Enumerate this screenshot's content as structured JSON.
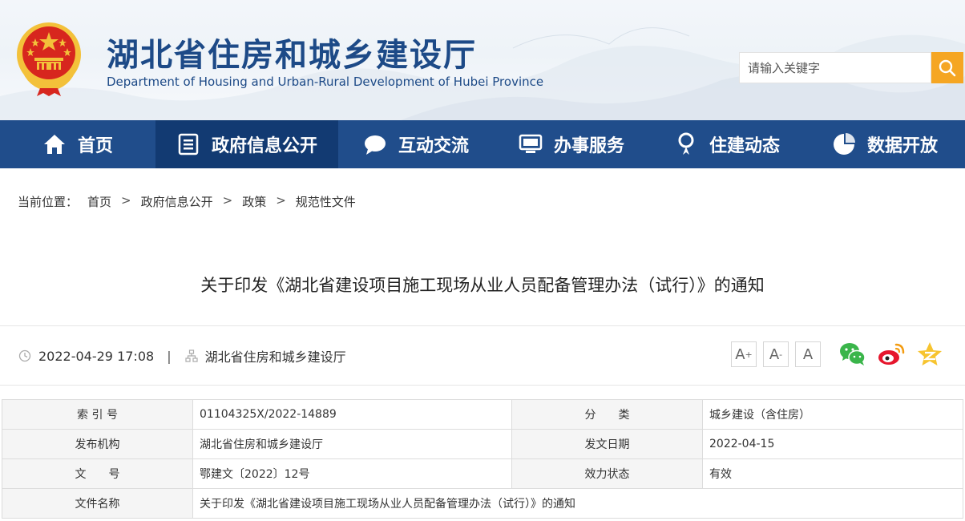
{
  "header": {
    "title": "湖北省住房和城乡建设厅",
    "subtitle": "Department of Housing and Urban-Rural Development of Hubei Province",
    "search_placeholder": "请输入关键字"
  },
  "nav": {
    "items": [
      {
        "label": "首页",
        "icon": "home-icon"
      },
      {
        "label": "政府信息公开",
        "icon": "document-list-icon",
        "active": true
      },
      {
        "label": "互动交流",
        "icon": "chat-bubble-icon"
      },
      {
        "label": "办事服务",
        "icon": "monitor-icon"
      },
      {
        "label": "住建动态",
        "icon": "location-pin-icon"
      },
      {
        "label": "数据开放",
        "icon": "pie-chart-icon"
      }
    ]
  },
  "breadcrumb": {
    "prefix": "当前位置：",
    "items": [
      "首页",
      "政府信息公开",
      "政策",
      "规范性文件"
    ],
    "separator": ">"
  },
  "article": {
    "title": "关于印发《湖北省建设项目施工现场从业人员配备管理办法（试行）》的通知",
    "datetime": "2022-04-29 17:08",
    "pipe": "|",
    "source": "湖北省住房和城乡建设厅"
  },
  "font_controls": {
    "increase": "A",
    "increase_sup": "+",
    "decrease": "A",
    "decrease_sup": "-",
    "reset": "A"
  },
  "share": [
    "wechat-icon",
    "weibo-icon",
    "qzone-icon"
  ],
  "info_table": {
    "rows": [
      {
        "l1": "索 引 号",
        "v1": "01104325X/2022-14889",
        "l2": "分　　类",
        "v2": "城乡建设（含住房）"
      },
      {
        "l1": "发布机构",
        "v1": "湖北省住房和城乡建设厅",
        "l2": "发文日期",
        "v2": "2022-04-15"
      },
      {
        "l1": "文　　号",
        "v1": "鄂建文〔2022〕12号",
        "l2": "效力状态",
        "v2": "有效"
      },
      {
        "l1": "文件名称",
        "v1": "关于印发《湖北省建设项目施工现场从业人员配备管理办法（试行）》的通知"
      }
    ]
  },
  "colors": {
    "brand_blue": "#204d8b",
    "nav_active": "#123a72",
    "search_button": "#f5a623",
    "emblem_red": "#d7261e",
    "emblem_gold": "#f3c13a"
  }
}
